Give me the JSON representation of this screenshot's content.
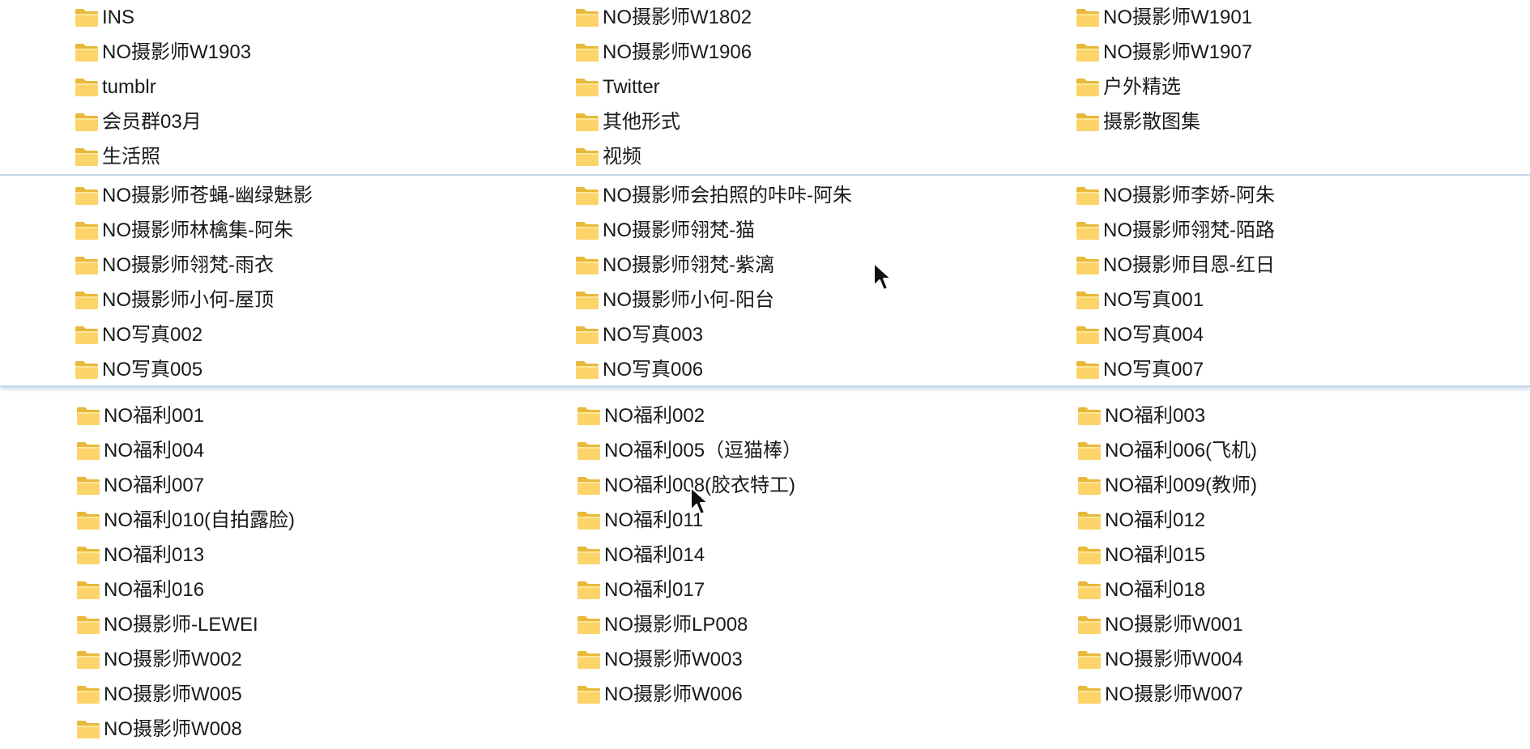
{
  "colors": {
    "folder_back": "#e8b93a",
    "folder_front": "#fcd46a",
    "selection_border": "#c4d8ec",
    "text": "#1a1a1a"
  },
  "groups": [
    {
      "items": [
        "INS",
        "NO摄影师W1802",
        "NO摄影师W1901",
        "NO摄影师W1903",
        "NO摄影师W1906",
        "NO摄影师W1907",
        "tumblr",
        "Twitter",
        "户外精选",
        "会员群03月",
        "其他形式",
        "摄影散图集",
        "生活照",
        "视频"
      ]
    },
    {
      "items": [
        "NO摄影师苍蝇-幽绿魅影",
        "NO摄影师会拍照的咔咔-阿朱",
        "NO摄影师李娇-阿朱",
        "NO摄影师林檎集-阿朱",
        "NO摄影师翎梵-猫",
        "NO摄影师翎梵-陌路",
        "NO摄影师翎梵-雨衣",
        "NO摄影师翎梵-紫漓",
        "NO摄影师目恩-红日",
        "NO摄影师小何-屋顶",
        "NO摄影师小何-阳台",
        "NO写真001",
        "NO写真002",
        "NO写真003",
        "NO写真004",
        "NO写真005",
        "NO写真006",
        "NO写真007"
      ]
    },
    {
      "items": [
        "NO福利001",
        "NO福利002",
        "NO福利003",
        "NO福利004",
        "NO福利005（逗猫棒）",
        "NO福利006(飞机)",
        "NO福利007",
        "NO福利008(胶衣特工)",
        "NO福利009(教师)",
        "NO福利010(自拍露脸)",
        "NO福利011",
        "NO福利012",
        "NO福利013",
        "NO福利014",
        "NO福利015",
        "NO福利016",
        "NO福利017",
        "NO福利018",
        "NO摄影师-LEWEI",
        "NO摄影师LP008",
        "NO摄影师W001",
        "NO摄影师W002",
        "NO摄影师W003",
        "NO摄影师W004",
        "NO摄影师W005",
        "NO摄影师W006",
        "NO摄影师W007",
        "NO摄影师W008"
      ]
    }
  ],
  "icons": {
    "item": "folder-icon",
    "pointer": "mouse-pointer-icon"
  }
}
